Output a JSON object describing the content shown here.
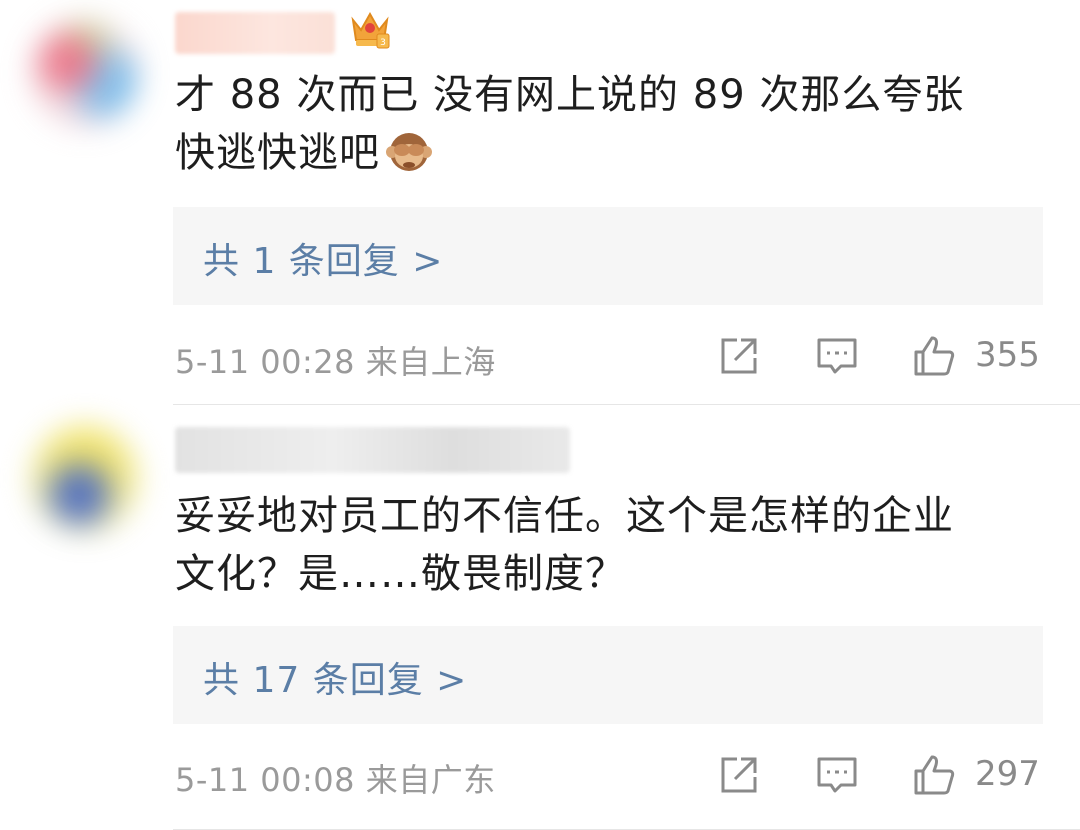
{
  "comments": [
    {
      "text_line1": "才 88 次而已 没有网上说的 89 次那么夸张",
      "text_line2": "快逃快逃吧",
      "emoji_icon": "see-no-evil-monkey-icon",
      "badge_icon": "crown-badge-icon",
      "replies_label": "共 1 条回复 >",
      "meta": "5-11 00:28  来自上海",
      "likes": "355"
    },
    {
      "text_line1": "妥妥地对员工的不信任。这个是怎样的企业",
      "text_line2": "文化？是……敬畏制度？",
      "replies_label": "共 17 条回复 >",
      "meta": "5-11 00:08  来自广东",
      "likes": "297"
    }
  ],
  "colors": {
    "link": "#5b7ea6",
    "meta": "#9a9a9a",
    "reply_bg": "#f6f6f6"
  }
}
